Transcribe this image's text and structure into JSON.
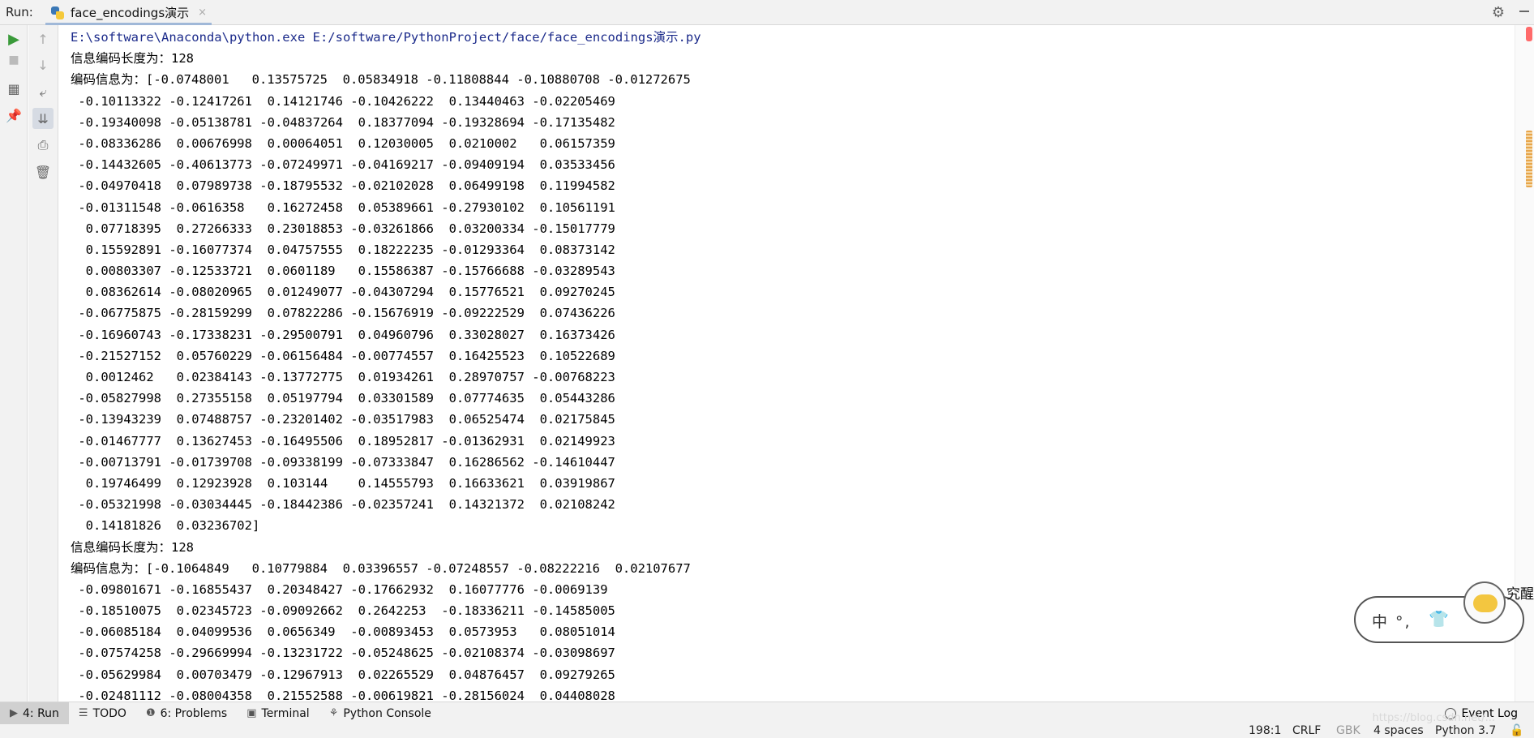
{
  "header": {
    "run_label": "Run:",
    "tab_title": "face_encodings演示",
    "tab_close": "×"
  },
  "left_toolbar": {
    "icons": [
      "run-icon",
      "stop-icon",
      "layout-icon",
      "pin-icon",
      "up-arrow-icon",
      "down-arrow-icon",
      "soft-wrap-icon",
      "scroll-to-end-icon",
      "print-icon",
      "trash-icon"
    ]
  },
  "console": {
    "lines": [
      "E:\\software\\Anaconda\\python.exe E:/software/PythonProject/face/face_encodings演示.py",
      "信息编码长度为：128",
      "编码信息为：[-0.0748001   0.13575725  0.05834918 -0.11808844 -0.10880708 -0.01272675",
      " -0.10113322 -0.12417261  0.14121746 -0.10426222  0.13440463 -0.02205469",
      " -0.19340098 -0.05138781 -0.04837264  0.18377094 -0.19328694 -0.17135482",
      " -0.08336286  0.00676998  0.00064051  0.12030005  0.0210002   0.06157359",
      " -0.14432605 -0.40613773 -0.07249971 -0.04169217 -0.09409194  0.03533456",
      " -0.04970418  0.07989738 -0.18795532 -0.02102028  0.06499198  0.11994582",
      " -0.01311548 -0.0616358   0.16272458  0.05389661 -0.27930102  0.10561191",
      "  0.07718395  0.27266333  0.23018853 -0.03261866  0.03200334 -0.15017779",
      "  0.15592891 -0.16077374  0.04757555  0.18222235 -0.01293364  0.08373142",
      "  0.00803307 -0.12533721  0.0601189   0.15586387 -0.15766688 -0.03289543",
      "  0.08362614 -0.08020965  0.01249077 -0.04307294  0.15776521  0.09270245",
      " -0.06775875 -0.28159299  0.07822286 -0.15676919 -0.09222529  0.07436226",
      " -0.16960743 -0.17338231 -0.29500791  0.04960796  0.33028027  0.16373426",
      " -0.21527152  0.05760229 -0.06156484 -0.00774557  0.16425523  0.10522689",
      "  0.0012462   0.02384143 -0.13772775  0.01934261  0.28970757 -0.00768223",
      " -0.05827998  0.27355158  0.05197794  0.03301589  0.07774635  0.05443286",
      " -0.13943239  0.07488757 -0.23201402 -0.03517983  0.06525474  0.02175845",
      " -0.01467777  0.13627453 -0.16495506  0.18952817 -0.01362931  0.02149923",
      " -0.00713791 -0.01739708 -0.09338199 -0.07333847  0.16286562 -0.14610447",
      "  0.19746499  0.12923928  0.103144    0.14555793  0.16633621  0.03919867",
      " -0.05321998 -0.03034445 -0.18442386 -0.02357241  0.14321372  0.02108242",
      "  0.14181826  0.03236702]",
      "信息编码长度为：128",
      "编码信息为：[-0.1064849   0.10779884  0.03396557 -0.07248557 -0.08222216  0.02107677",
      " -0.09801671 -0.16855437  0.20348427 -0.17662932  0.16077776 -0.0069139",
      " -0.18510075  0.02345723 -0.09092662  0.2642253  -0.18336211 -0.14585005",
      " -0.06085184  0.04099536  0.0656349  -0.00893453  0.0573953   0.08051014",
      " -0.07574258 -0.29669994 -0.13231722 -0.05248625 -0.02108374 -0.03098697",
      " -0.05629984  0.00703479 -0.12967913  0.02265529  0.04876457  0.09279265",
      " -0.02481112 -0.08004358  0.21552588 -0.00619821 -0.28156024  0.04408028"
    ]
  },
  "bottom_tabs": {
    "run": "4: Run",
    "todo": "TODO",
    "problems": "6: Problems",
    "terminal": "Terminal",
    "python_console": "Python Console",
    "event_log": "Event Log"
  },
  "status": {
    "position": "198:1",
    "line_sep": "CRLF",
    "encoding": "GBK",
    "indent": "4 spaces",
    "interpreter": "Python 3.7"
  },
  "watermark": "https://blog.csdn.net/...",
  "ime": {
    "text": "中 °,",
    "badge": "究醒"
  }
}
